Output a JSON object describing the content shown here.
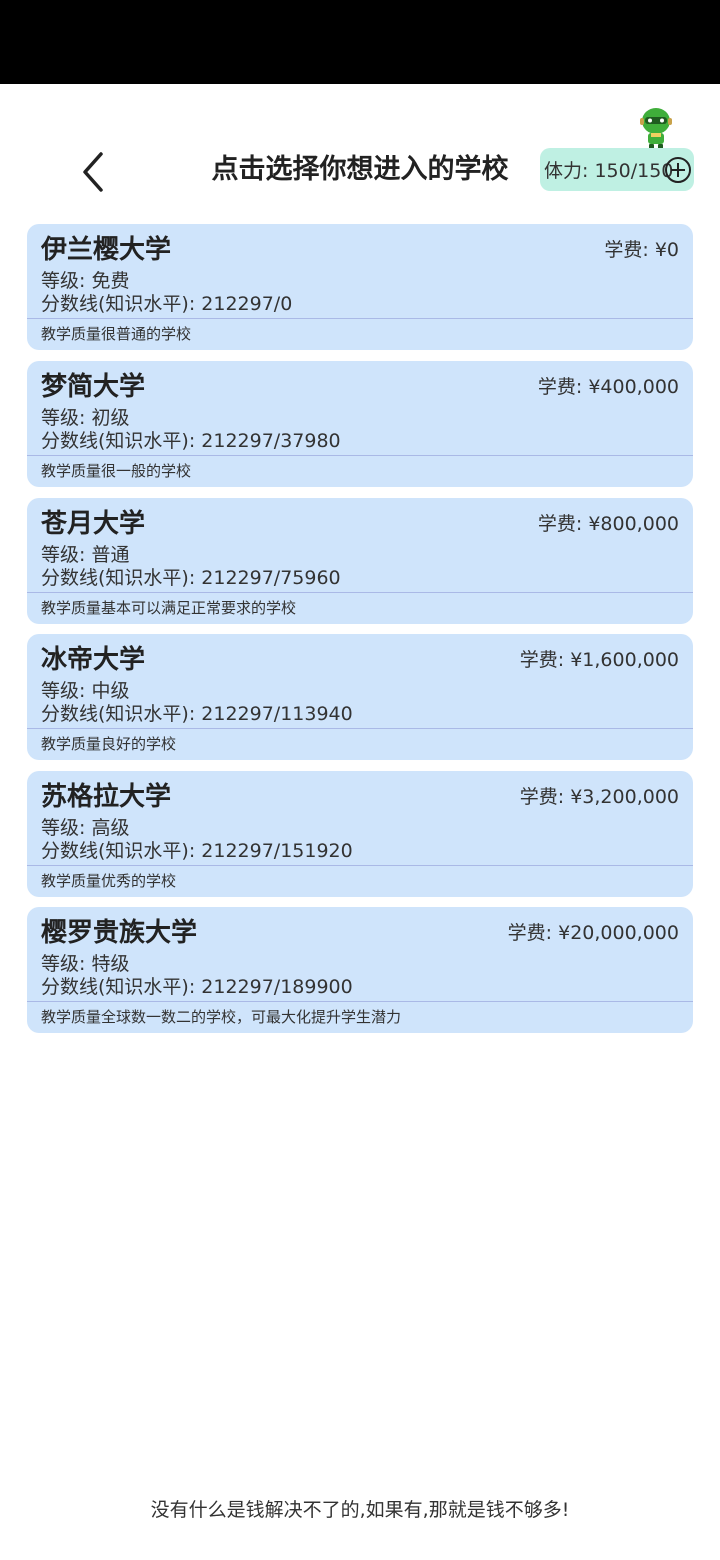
{
  "header": {
    "title": "点击选择你想进入的学校",
    "stamina_text": "体力: 150/150"
  },
  "icons": {
    "back": "chevron-left-icon",
    "mascot": "mascot-icon",
    "add": "plus-circle-icon"
  },
  "colors": {
    "card_bg": "#cfe4fb",
    "stamina_bg": "#bff0e3",
    "status_bar": "#000000"
  },
  "schools": [
    {
      "name": "伊兰樱大学",
      "fee": "学费: ¥0",
      "grade": "等级: 免费",
      "score": "分数线(知识水平): 212297/0",
      "desc": "教学质量很普通的学校"
    },
    {
      "name": "梦简大学",
      "fee": "学费: ¥400,000",
      "grade": "等级: 初级",
      "score": "分数线(知识水平): 212297/37980",
      "desc": "教学质量很一般的学校"
    },
    {
      "name": "苍月大学",
      "fee": "学费: ¥800,000",
      "grade": "等级: 普通",
      "score": "分数线(知识水平): 212297/75960",
      "desc": "教学质量基本可以满足正常要求的学校"
    },
    {
      "name": "冰帝大学",
      "fee": "学费: ¥1,600,000",
      "grade": "等级: 中级",
      "score": "分数线(知识水平): 212297/113940",
      "desc": "教学质量良好的学校"
    },
    {
      "name": "苏格拉大学",
      "fee": "学费: ¥3,200,000",
      "grade": "等级: 高级",
      "score": "分数线(知识水平): 212297/151920",
      "desc": "教学质量优秀的学校"
    },
    {
      "name": "樱罗贵族大学",
      "fee": "学费: ¥20,000,000",
      "grade": "等级: 特级",
      "score": "分数线(知识水平): 212297/189900",
      "desc": "教学质量全球数一数二的学校，可最大化提升学生潜力"
    }
  ],
  "footer": {
    "quote": "没有什么是钱解决不了的,如果有,那就是钱不够多!"
  }
}
